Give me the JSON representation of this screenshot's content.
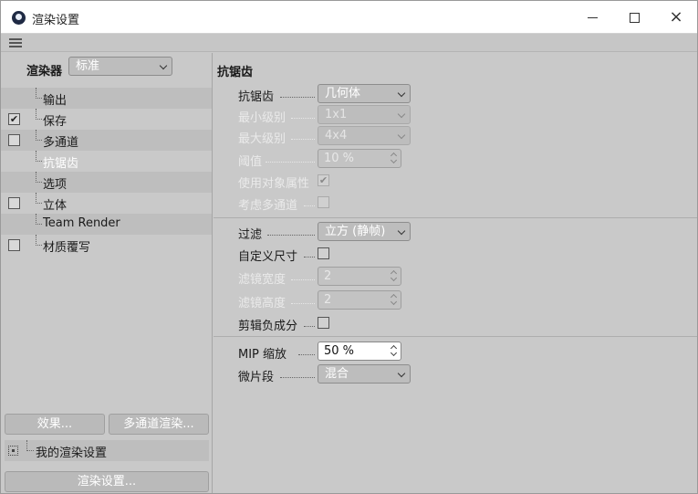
{
  "window": {
    "title": "渲染设置",
    "minimize": "minimize",
    "maximize": "maximize",
    "close": "×"
  },
  "left": {
    "renderer_label": "渲染器",
    "renderer_value": "标准",
    "tree": [
      {
        "label": "输出",
        "checkbox": false,
        "checked": false
      },
      {
        "label": "保存",
        "checkbox": true,
        "checked": true
      },
      {
        "label": "多通道",
        "checkbox": true,
        "checked": false
      },
      {
        "label": "抗锯齿",
        "checkbox": false,
        "checked": false,
        "selected": true
      },
      {
        "label": "选项",
        "checkbox": false,
        "checked": false
      },
      {
        "label": "立体",
        "checkbox": true,
        "checked": false
      },
      {
        "label": "Team Render",
        "checkbox": false,
        "checked": false
      },
      {
        "label": "材质覆写",
        "checkbox": true,
        "checked": false
      }
    ],
    "effects_button": "效果...",
    "multipass_button": "多通道渲染...",
    "preset_label": "我的渲染设置",
    "render_settings_button": "渲染设置..."
  },
  "right": {
    "section_title": "抗锯齿",
    "antialiasing": {
      "label": "抗锯齿",
      "value": "几何体"
    },
    "min_level": {
      "label": "最小级别",
      "value": "1x1"
    },
    "max_level": {
      "label": "最大级别",
      "value": "4x4"
    },
    "threshold": {
      "label": "阈值",
      "value": "10 %"
    },
    "use_object_props": {
      "label": "使用对象属性",
      "checked": true
    },
    "consider_multipass": {
      "label": "考虑多通道",
      "checked": false
    },
    "filter": {
      "label": "过滤",
      "value": "立方 (静帧)"
    },
    "custom_size": {
      "label": "自定义尺寸",
      "checked": false
    },
    "filter_width": {
      "label": "滤镜宽度",
      "value": "2"
    },
    "filter_height": {
      "label": "滤镜高度",
      "value": "2"
    },
    "clip_negative": {
      "label": "剪辑负成分",
      "checked": false
    },
    "mip_scale": {
      "label": "MIP 缩放",
      "value": "50 %"
    },
    "micropolygon": {
      "label": "微片段",
      "value": "混合"
    }
  },
  "icons": {
    "app": "cinema4d-icon",
    "menu": "hamburger-icon",
    "check": "✔"
  }
}
